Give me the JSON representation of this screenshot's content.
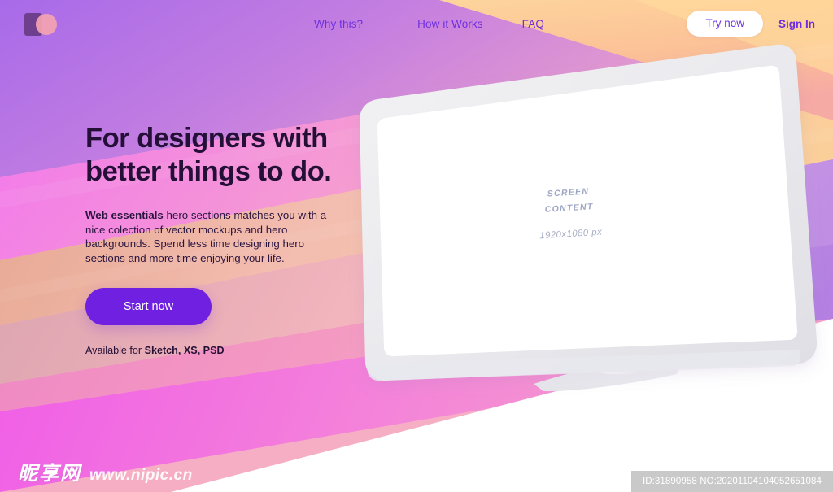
{
  "header": {
    "logo": {
      "name": "brand-logo"
    },
    "nav": [
      {
        "label": "Why this?",
        "name": "nav-why-this"
      },
      {
        "label": "How it Works",
        "name": "nav-how-it-works"
      },
      {
        "label": "FAQ",
        "name": "nav-faq"
      }
    ],
    "try_now_label": "Try now",
    "sign_in_label": "Sign In"
  },
  "hero": {
    "headline": "For designers with\nbetter things to do.",
    "paragraph_bold": "Web essentials",
    "paragraph_rest": " hero sections matches you with a nice colection of vector mockups and hero backgrounds. Spend less time designing hero sections and more time enjoying your life.",
    "cta_label": "Start now",
    "available_prefix": "Available for ",
    "available_sketch": "Sketch",
    "available_rest": ", XS, PSD"
  },
  "mockup": {
    "screen_line1": "SCREEN",
    "screen_line2": "CONTENT",
    "screen_dimensions": "1920x1080 px"
  },
  "watermark": {
    "site_cn": "昵享网",
    "site_url": "www.nipic.cn",
    "id_text": "ID:31890958 NO:20201104104052651084"
  },
  "colors": {
    "accent_purple": "#6f20e0",
    "nav_purple": "#6f2fe0",
    "headline_dark": "#241037",
    "stripe_violet": "#a96ae8",
    "stripe_magenta": "#f07ae8",
    "stripe_peach": "#e9b098",
    "stripe_pink": "#f6a6bd",
    "stripe_orange": "#fbc98f",
    "screen_text": "#9da5c4",
    "idbar_bg": "#c9c9c9"
  }
}
